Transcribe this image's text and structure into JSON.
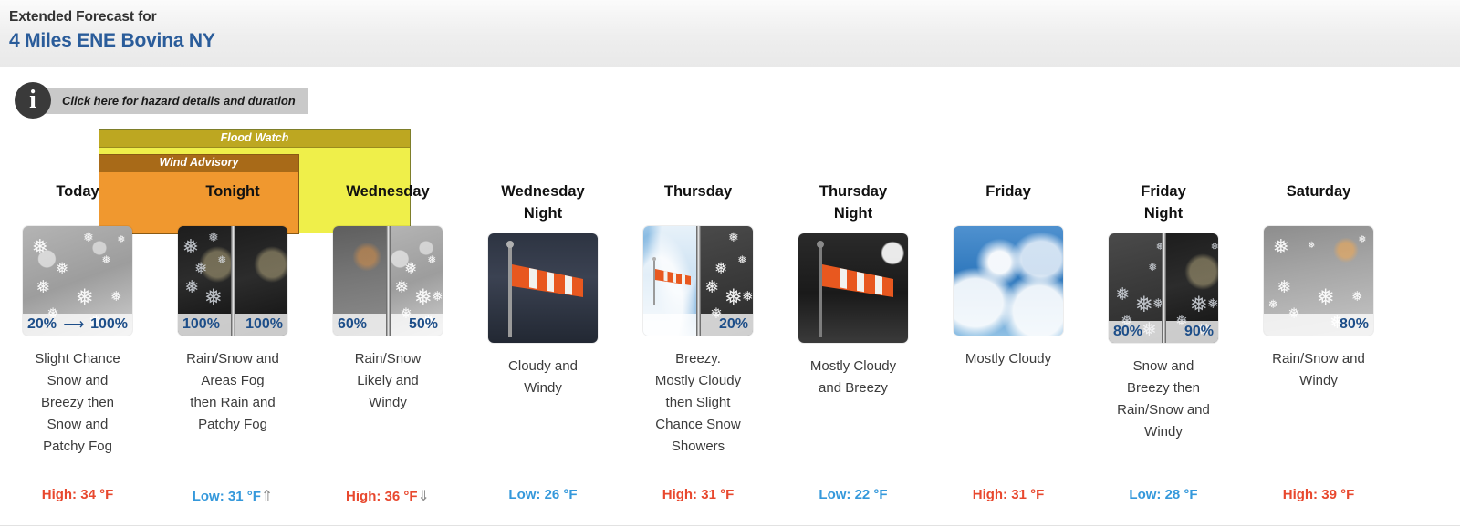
{
  "header": {
    "line1": "Extended Forecast for",
    "line2": "4 Miles ENE Bovina NY"
  },
  "hazard_bar": {
    "icon": "info-icon",
    "glyph": "i",
    "label": "Click here for hazard details and duration"
  },
  "hazards": [
    {
      "name": "Flood Watch",
      "color": "#efef4a",
      "title_color": "#bda721"
    },
    {
      "name": "Wind Advisory",
      "color": "#f0982f",
      "title_color": "#a86a18"
    }
  ],
  "periods": [
    {
      "day": "Today",
      "icon": "snow-day-icon",
      "pct_left": "20%",
      "pct_arrow": "⟶",
      "pct_right": "100%",
      "split": false,
      "description": "Slight Chance\nSnow and\nBreezy then\nSnow and\nPatchy Fog",
      "temp_label": "High:",
      "temp_value": "34 °F",
      "temp_kind": "hi",
      "trend": ""
    },
    {
      "day": "Tonight",
      "icon": "snow-night-split-icon",
      "pct_left": "100%",
      "pct_arrow": "",
      "pct_right": "100%",
      "split": true,
      "description": "Rain/Snow and\nAreas Fog\nthen Rain and\nPatchy Fog",
      "temp_label": "Low:",
      "temp_value": "31 °F",
      "temp_kind": "lo",
      "trend": "⇑"
    },
    {
      "day": "Wednesday",
      "icon": "rain-snow-split-icon",
      "pct_left": "60%",
      "pct_arrow": "",
      "pct_right": "50%",
      "split": true,
      "description": "Rain/Snow\nLikely and\nWindy",
      "temp_label": "High:",
      "temp_value": "36 °F",
      "temp_kind": "hi",
      "trend": "⇓"
    },
    {
      "day": "Wednesday\nNight",
      "icon": "windy-night-icon",
      "pct_left": "",
      "pct_arrow": "",
      "pct_right": "",
      "split": false,
      "description": "Cloudy and\nWindy",
      "temp_label": "Low:",
      "temp_value": "26 °F",
      "temp_kind": "lo",
      "trend": ""
    },
    {
      "day": "Thursday",
      "icon": "windy-then-snow-split-icon",
      "pct_left": "",
      "pct_arrow": "",
      "pct_right": "20%",
      "split": true,
      "description": "Breezy.\nMostly Cloudy\nthen Slight\nChance Snow\nShowers",
      "temp_label": "High:",
      "temp_value": "31 °F",
      "temp_kind": "hi",
      "trend": ""
    },
    {
      "day": "Thursday\nNight",
      "icon": "mostly-cloudy-breezy-night-icon",
      "pct_left": "",
      "pct_arrow": "",
      "pct_right": "",
      "split": false,
      "description": "Mostly Cloudy\nand Breezy",
      "temp_label": "Low:",
      "temp_value": "22 °F",
      "temp_kind": "lo",
      "trend": ""
    },
    {
      "day": "Friday",
      "icon": "mostly-cloudy-icon",
      "pct_left": "",
      "pct_arrow": "",
      "pct_right": "",
      "split": false,
      "description": "Mostly Cloudy",
      "temp_label": "High:",
      "temp_value": "31 °F",
      "temp_kind": "hi",
      "trend": ""
    },
    {
      "day": "Friday\nNight",
      "icon": "snow-then-rain-snow-split-icon",
      "pct_left": "80%",
      "pct_arrow": "",
      "pct_right": "90%",
      "split": true,
      "description": "Snow and\nBreezy then\nRain/Snow and\nWindy",
      "temp_label": "Low:",
      "temp_value": "28 °F",
      "temp_kind": "lo",
      "trend": ""
    },
    {
      "day": "Saturday",
      "icon": "rain-snow-windy-icon",
      "pct_left": "",
      "pct_arrow": "",
      "pct_right": "80%",
      "split": false,
      "description": "Rain/Snow and\nWindy",
      "temp_label": "High:",
      "temp_value": "39 °F",
      "temp_kind": "hi",
      "trend": ""
    }
  ],
  "colors": {
    "high": "#e8482e",
    "low": "#3498db",
    "link": "#2a5c9a",
    "pct": "#1d4e89"
  }
}
